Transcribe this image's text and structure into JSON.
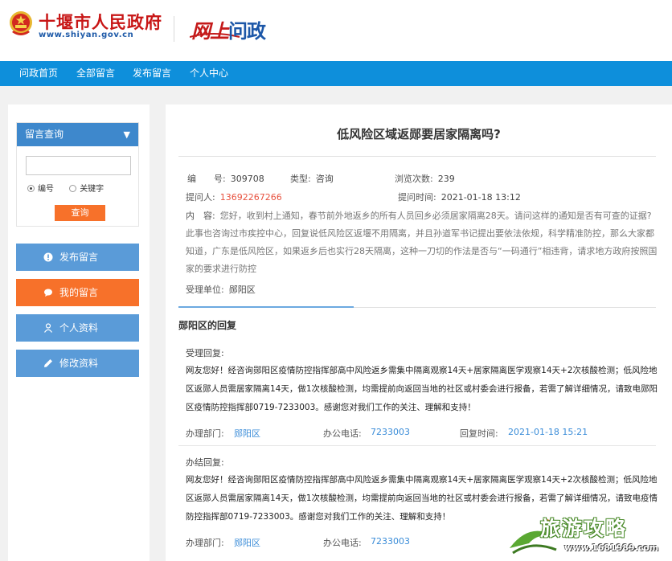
{
  "header": {
    "site_name": "十堰市人民政府",
    "site_url": "www.shiyan.gov.cn",
    "logo_part1": "网上",
    "logo_part2": "问政"
  },
  "nav": {
    "items": [
      "问政首页",
      "全部留言",
      "发布留言",
      "个人中心"
    ]
  },
  "sidebar": {
    "query_title": "留言查询",
    "search_placeholder": "",
    "radio_number": "编号",
    "radio_keyword": "关键字",
    "query_button": "查询",
    "buttons": [
      "发布留言",
      "我的留言",
      "个人资料",
      "修改资料"
    ]
  },
  "article": {
    "title": "低风险区域返郧要居家隔离吗?",
    "number_label": "编　　号:",
    "number": "309708",
    "type_label": "类型:",
    "type": "咨询",
    "views_label": "浏览次数:",
    "views": "239",
    "asker_label": "提问人:",
    "asker": "13692267266",
    "time_label": "提问时间:",
    "time": "2021-01-18 13:12",
    "content_label": "内　容:",
    "content": "您好，收到村上通知，春节前外地返乡的所有人员回乡必须居家隔离28天。请问这样的通知是否有可查的证据?此事也咨询过市疾控中心，回复说低风险区返堰不用隔离，并且孙道军书记提出要依法依规，科学精准防控，那么大家都知道，广东是低风险区，如果返乡后也实行28天隔离，这种一刀切的作法是否与“一码通行”相违背，请求地方政府按照国家的要求进行防控",
    "unit_label": "受理单位:",
    "unit": "郧阳区"
  },
  "reply": {
    "section_title": "郧阳区的回复",
    "accept_label": "受理回复:",
    "accept_text": "网友您好！经咨询郧阳区疫情防控指挥部高中风险返乡需集中隔离观察14天+居家隔离医学观察14天+2次核酸检测；低风险地区返郧人员需居家隔离14天，做1次核酸检测，均需提前向返回当地的社区或村委会进行报备，若需了解详细情况，请致电郧阳区疫情防控指挥部0719-7233003。感谢您对我们工作的关注、理解和支持！",
    "dept_label": "办理部门:",
    "dept": "郧阳区",
    "phone_label": "办公电话:",
    "phone": "7233003",
    "reply_time_label": "回复时间:",
    "reply_time": "2021-01-18 15:21",
    "final_label": "办结回复:",
    "final_text": "网友您好！经咨询郧阳区疫情防控指挥部高中风险返乡需集中隔离观察14天+居家隔离医学观察14天+2次核酸检测；低风险地区返郧人员需居家隔离14天，做1次核酸检测，均需提前向返回当地的社区或村委会进行报备，若需了解详细情况，请致电疫情防控指挥部0719-7233003。感谢您对我们工作的关注、理解和支持！",
    "final_dept_label": "办理部门:",
    "final_dept": "郧阳区",
    "final_phone_label": "办公电话:",
    "final_phone": "7233003"
  },
  "watermark": {
    "text": "旅游攻略",
    "url": "www.1681989.com"
  }
}
